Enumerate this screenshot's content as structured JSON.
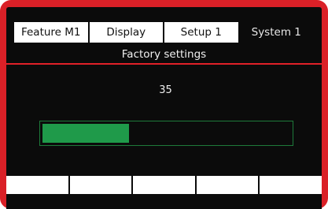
{
  "tabs": [
    {
      "label": "Feature  M1",
      "active": false
    },
    {
      "label": "Display",
      "active": false
    },
    {
      "label": "Setup 1",
      "active": false
    },
    {
      "label": "System 1",
      "active": true
    }
  ],
  "header": {
    "title": "Factory settings"
  },
  "progress": {
    "value_text": "35",
    "fraction": 0.35
  },
  "softkeys": [
    "",
    "",
    "",
    "",
    ""
  ],
  "colors": {
    "bezel": "#da2027",
    "screen": "#0b0b0b",
    "accent_rule": "#e02028",
    "progress_fill": "#1f9a4a",
    "progress_border": "#1e7a3a"
  }
}
